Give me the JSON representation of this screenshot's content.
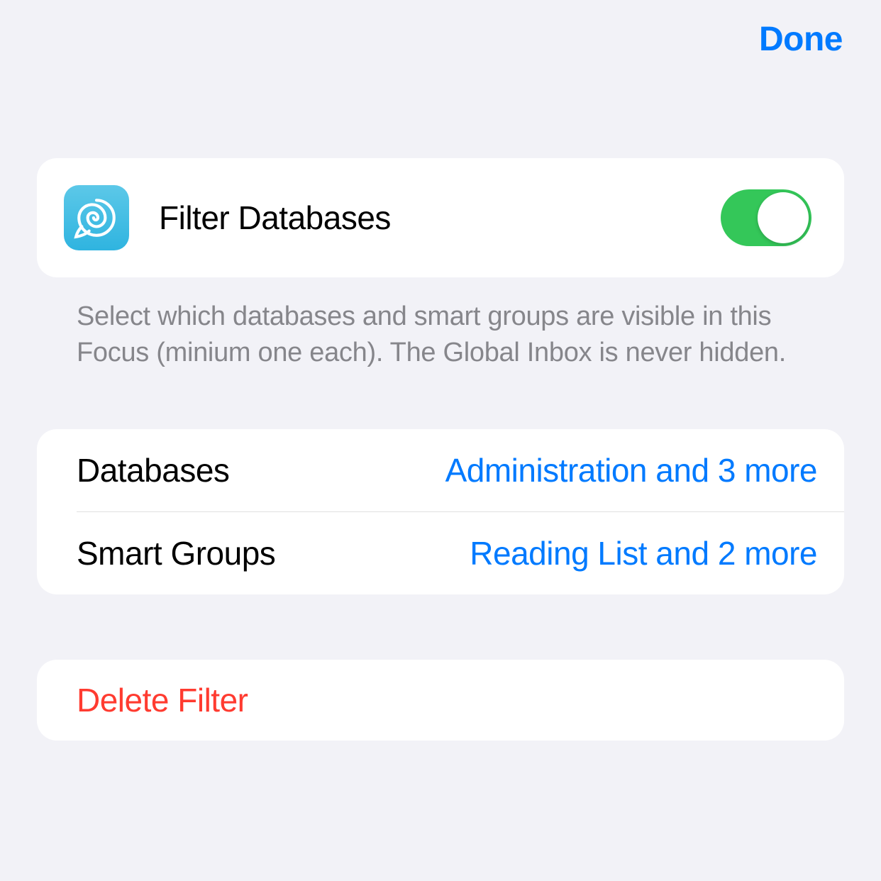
{
  "header": {
    "done_label": "Done"
  },
  "filter": {
    "title": "Filter Databases",
    "description": "Select which databases and smart groups are visible in this Focus (minium one each). The Global Inbox is never hidden.",
    "toggle_on": true
  },
  "rows": [
    {
      "label": "Databases",
      "value": "Administration and 3 more"
    },
    {
      "label": "Smart Groups",
      "value": "Reading List and 2 more"
    }
  ],
  "delete": {
    "label": "Delete Filter"
  },
  "colors": {
    "accent": "#007aff",
    "green": "#34c759",
    "red": "#ff3b30",
    "background": "#f2f2f7"
  }
}
